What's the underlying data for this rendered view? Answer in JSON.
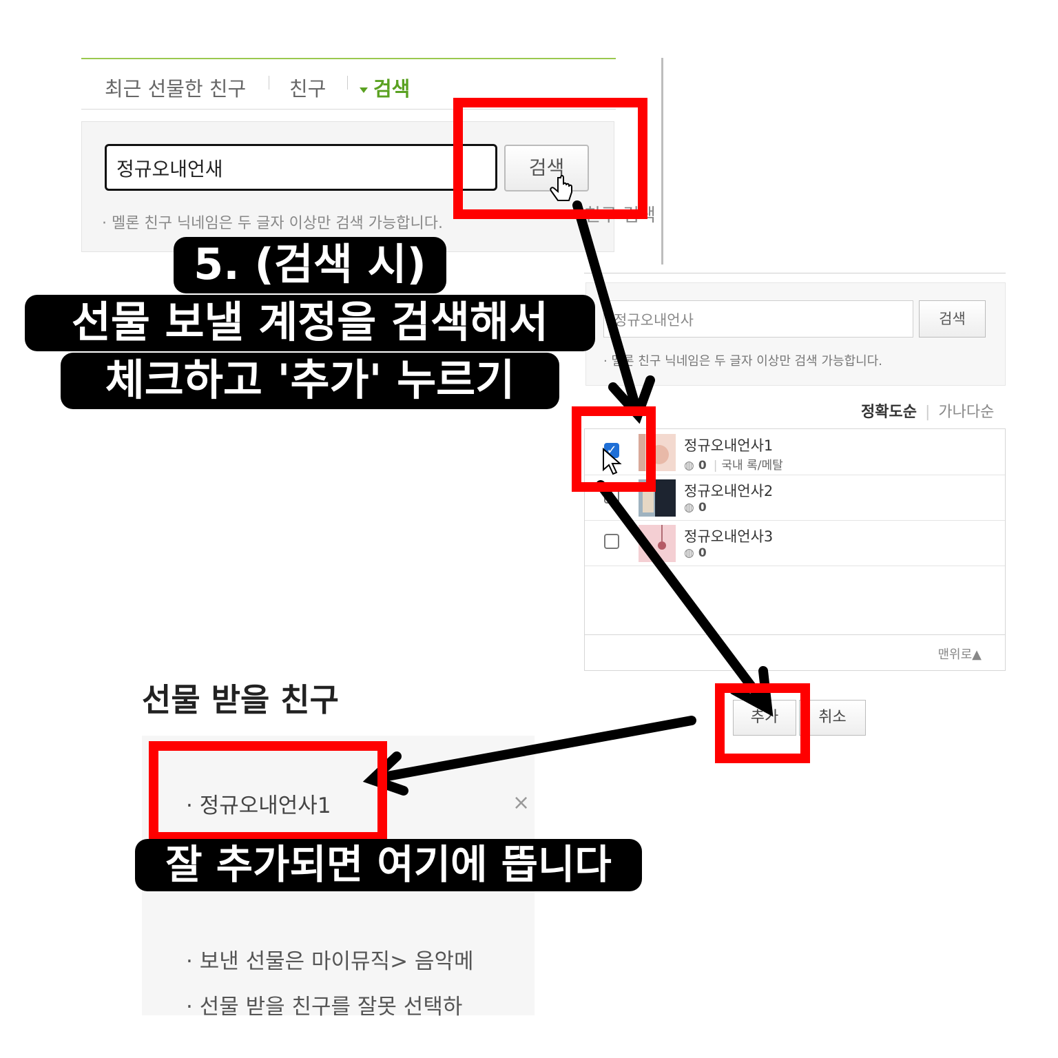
{
  "tabs": {
    "recent": "최근 선물한 친구",
    "friends": "친구",
    "search": "검색"
  },
  "search_panel": {
    "input_value": "정규오내언새",
    "button": "검색",
    "hint": "멜론 친구 닉네임은 두 글자 이상만 검색 가능합니다.",
    "peek_text": "친구 검색"
  },
  "result_panel": {
    "input_value": "정규오내언사",
    "button": "검색",
    "hint": "멜론 친구 닉네임은 두 글자 이상만 검색 가능합니다.",
    "sort_accuracy": "정확도순",
    "sort_alpha": "가나다순",
    "rows": [
      {
        "name": "정규오내언사1",
        "count": "0",
        "genre": "국내 록/메탈",
        "checked": true
      },
      {
        "name": "정규오내언사2",
        "count": "0",
        "genre": "",
        "checked": false
      },
      {
        "name": "정규오내언사3",
        "count": "0",
        "genre": "",
        "checked": false
      }
    ],
    "to_top": "맨위로▲",
    "add_button": "추가",
    "cancel_button": "취소"
  },
  "receiver": {
    "title": "선물 받을 친구",
    "item": "· 정규오내언사1",
    "remove": "×",
    "note1": "· 보낸 선물은 마이뮤직> 음악메",
    "note2": "· 선물 받을 친구를 잘못 선택하"
  },
  "captions": {
    "step_line1": "5. (검색 시)",
    "step_line2": "선물 보낼 계정을 검색해서",
    "step_line3": "체크하고 '추가' 누르기",
    "result": "잘 추가되면 여기에 뜹니다"
  },
  "colors": {
    "highlight": "#ff0000",
    "accent_green": "#5aa121",
    "checkbox_blue": "#1f6fd6"
  }
}
